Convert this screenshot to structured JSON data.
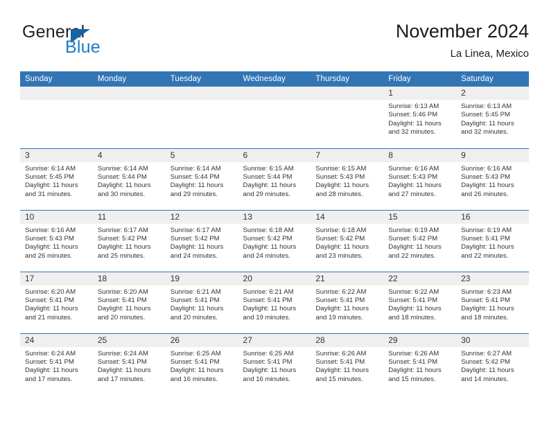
{
  "brand": {
    "name_part1": "General",
    "name_part2": "Blue",
    "flag_icon": "blue-triangle-flag"
  },
  "header": {
    "title": "November 2024",
    "location": "La Linea, Mexico"
  },
  "calendar": {
    "weekday_headers": [
      "Sunday",
      "Monday",
      "Tuesday",
      "Wednesday",
      "Thursday",
      "Friday",
      "Saturday"
    ],
    "colors": {
      "header_blue": "#3275b5",
      "daynum_gray": "#efefef",
      "logo_blue": "#1d7cc4",
      "flag_blue": "#1664a8",
      "text": "#333333"
    },
    "weeks": [
      [
        {
          "day": "",
          "sunrise": "",
          "sunset": "",
          "daylight_line1": "",
          "daylight_line2": ""
        },
        {
          "day": "",
          "sunrise": "",
          "sunset": "",
          "daylight_line1": "",
          "daylight_line2": ""
        },
        {
          "day": "",
          "sunrise": "",
          "sunset": "",
          "daylight_line1": "",
          "daylight_line2": ""
        },
        {
          "day": "",
          "sunrise": "",
          "sunset": "",
          "daylight_line1": "",
          "daylight_line2": ""
        },
        {
          "day": "",
          "sunrise": "",
          "sunset": "",
          "daylight_line1": "",
          "daylight_line2": ""
        },
        {
          "day": "1",
          "sunrise": "Sunrise: 6:13 AM",
          "sunset": "Sunset: 5:46 PM",
          "daylight_line1": "Daylight: 11 hours",
          "daylight_line2": "and 32 minutes."
        },
        {
          "day": "2",
          "sunrise": "Sunrise: 6:13 AM",
          "sunset": "Sunset: 5:45 PM",
          "daylight_line1": "Daylight: 11 hours",
          "daylight_line2": "and 32 minutes."
        }
      ],
      [
        {
          "day": "3",
          "sunrise": "Sunrise: 6:14 AM",
          "sunset": "Sunset: 5:45 PM",
          "daylight_line1": "Daylight: 11 hours",
          "daylight_line2": "and 31 minutes."
        },
        {
          "day": "4",
          "sunrise": "Sunrise: 6:14 AM",
          "sunset": "Sunset: 5:44 PM",
          "daylight_line1": "Daylight: 11 hours",
          "daylight_line2": "and 30 minutes."
        },
        {
          "day": "5",
          "sunrise": "Sunrise: 6:14 AM",
          "sunset": "Sunset: 5:44 PM",
          "daylight_line1": "Daylight: 11 hours",
          "daylight_line2": "and 29 minutes."
        },
        {
          "day": "6",
          "sunrise": "Sunrise: 6:15 AM",
          "sunset": "Sunset: 5:44 PM",
          "daylight_line1": "Daylight: 11 hours",
          "daylight_line2": "and 29 minutes."
        },
        {
          "day": "7",
          "sunrise": "Sunrise: 6:15 AM",
          "sunset": "Sunset: 5:43 PM",
          "daylight_line1": "Daylight: 11 hours",
          "daylight_line2": "and 28 minutes."
        },
        {
          "day": "8",
          "sunrise": "Sunrise: 6:16 AM",
          "sunset": "Sunset: 5:43 PM",
          "daylight_line1": "Daylight: 11 hours",
          "daylight_line2": "and 27 minutes."
        },
        {
          "day": "9",
          "sunrise": "Sunrise: 6:16 AM",
          "sunset": "Sunset: 5:43 PM",
          "daylight_line1": "Daylight: 11 hours",
          "daylight_line2": "and 26 minutes."
        }
      ],
      [
        {
          "day": "10",
          "sunrise": "Sunrise: 6:16 AM",
          "sunset": "Sunset: 5:43 PM",
          "daylight_line1": "Daylight: 11 hours",
          "daylight_line2": "and 26 minutes."
        },
        {
          "day": "11",
          "sunrise": "Sunrise: 6:17 AM",
          "sunset": "Sunset: 5:42 PM",
          "daylight_line1": "Daylight: 11 hours",
          "daylight_line2": "and 25 minutes."
        },
        {
          "day": "12",
          "sunrise": "Sunrise: 6:17 AM",
          "sunset": "Sunset: 5:42 PM",
          "daylight_line1": "Daylight: 11 hours",
          "daylight_line2": "and 24 minutes."
        },
        {
          "day": "13",
          "sunrise": "Sunrise: 6:18 AM",
          "sunset": "Sunset: 5:42 PM",
          "daylight_line1": "Daylight: 11 hours",
          "daylight_line2": "and 24 minutes."
        },
        {
          "day": "14",
          "sunrise": "Sunrise: 6:18 AM",
          "sunset": "Sunset: 5:42 PM",
          "daylight_line1": "Daylight: 11 hours",
          "daylight_line2": "and 23 minutes."
        },
        {
          "day": "15",
          "sunrise": "Sunrise: 6:19 AM",
          "sunset": "Sunset: 5:42 PM",
          "daylight_line1": "Daylight: 11 hours",
          "daylight_line2": "and 22 minutes."
        },
        {
          "day": "16",
          "sunrise": "Sunrise: 6:19 AM",
          "sunset": "Sunset: 5:41 PM",
          "daylight_line1": "Daylight: 11 hours",
          "daylight_line2": "and 22 minutes."
        }
      ],
      [
        {
          "day": "17",
          "sunrise": "Sunrise: 6:20 AM",
          "sunset": "Sunset: 5:41 PM",
          "daylight_line1": "Daylight: 11 hours",
          "daylight_line2": "and 21 minutes."
        },
        {
          "day": "18",
          "sunrise": "Sunrise: 6:20 AM",
          "sunset": "Sunset: 5:41 PM",
          "daylight_line1": "Daylight: 11 hours",
          "daylight_line2": "and 20 minutes."
        },
        {
          "day": "19",
          "sunrise": "Sunrise: 6:21 AM",
          "sunset": "Sunset: 5:41 PM",
          "daylight_line1": "Daylight: 11 hours",
          "daylight_line2": "and 20 minutes."
        },
        {
          "day": "20",
          "sunrise": "Sunrise: 6:21 AM",
          "sunset": "Sunset: 5:41 PM",
          "daylight_line1": "Daylight: 11 hours",
          "daylight_line2": "and 19 minutes."
        },
        {
          "day": "21",
          "sunrise": "Sunrise: 6:22 AM",
          "sunset": "Sunset: 5:41 PM",
          "daylight_line1": "Daylight: 11 hours",
          "daylight_line2": "and 19 minutes."
        },
        {
          "day": "22",
          "sunrise": "Sunrise: 6:22 AM",
          "sunset": "Sunset: 5:41 PM",
          "daylight_line1": "Daylight: 11 hours",
          "daylight_line2": "and 18 minutes."
        },
        {
          "day": "23",
          "sunrise": "Sunrise: 6:23 AM",
          "sunset": "Sunset: 5:41 PM",
          "daylight_line1": "Daylight: 11 hours",
          "daylight_line2": "and 18 minutes."
        }
      ],
      [
        {
          "day": "24",
          "sunrise": "Sunrise: 6:24 AM",
          "sunset": "Sunset: 5:41 PM",
          "daylight_line1": "Daylight: 11 hours",
          "daylight_line2": "and 17 minutes."
        },
        {
          "day": "25",
          "sunrise": "Sunrise: 6:24 AM",
          "sunset": "Sunset: 5:41 PM",
          "daylight_line1": "Daylight: 11 hours",
          "daylight_line2": "and 17 minutes."
        },
        {
          "day": "26",
          "sunrise": "Sunrise: 6:25 AM",
          "sunset": "Sunset: 5:41 PM",
          "daylight_line1": "Daylight: 11 hours",
          "daylight_line2": "and 16 minutes."
        },
        {
          "day": "27",
          "sunrise": "Sunrise: 6:25 AM",
          "sunset": "Sunset: 5:41 PM",
          "daylight_line1": "Daylight: 11 hours",
          "daylight_line2": "and 16 minutes."
        },
        {
          "day": "28",
          "sunrise": "Sunrise: 6:26 AM",
          "sunset": "Sunset: 5:41 PM",
          "daylight_line1": "Daylight: 11 hours",
          "daylight_line2": "and 15 minutes."
        },
        {
          "day": "29",
          "sunrise": "Sunrise: 6:26 AM",
          "sunset": "Sunset: 5:41 PM",
          "daylight_line1": "Daylight: 11 hours",
          "daylight_line2": "and 15 minutes."
        },
        {
          "day": "30",
          "sunrise": "Sunrise: 6:27 AM",
          "sunset": "Sunset: 5:42 PM",
          "daylight_line1": "Daylight: 11 hours",
          "daylight_line2": "and 14 minutes."
        }
      ]
    ]
  }
}
